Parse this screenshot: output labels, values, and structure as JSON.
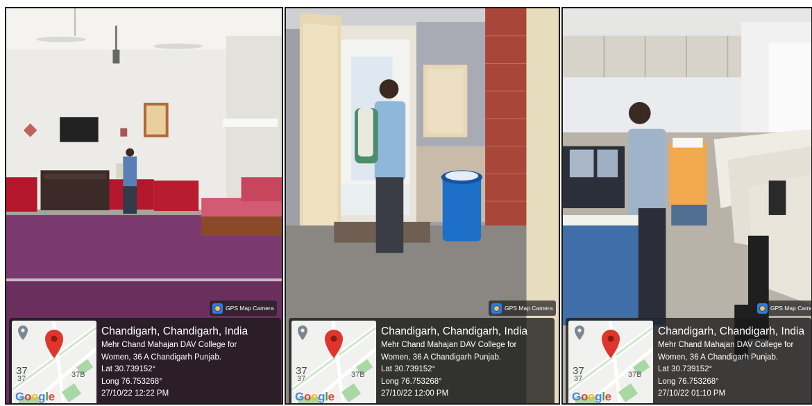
{
  "overlay": {
    "app_name": "GPS Map Camera",
    "map_label_main": "37",
    "map_label_sub": "37",
    "map_label_right": "37B",
    "map_brand": [
      "G",
      "o",
      "o",
      "g",
      "l",
      "e"
    ],
    "city": "Chandigarh, Chandigarh, India",
    "address_line1": "Mehr Chand Mahajan DAV College for",
    "address_line2": "Women, 36 A Chandigarh Punjab.",
    "lat": "Lat 30.739152°",
    "long": "Long 76.753268°"
  },
  "photos": [
    {
      "scene": "hall with purple carpet, red sofas and wall-mounted tv",
      "timestamp": "27/10/22 12:22 PM"
    },
    {
      "scene": "washroom corridor with blue dustbin and brick wall",
      "timestamp": "27/10/22 12:00 PM"
    },
    {
      "scene": "computer lab with cubicles",
      "timestamp": "27/10/22 01:10 PM"
    }
  ],
  "colors": {
    "card_bg": "#191919",
    "map_pin": "#e0352b",
    "carpet": "#6b2f5e"
  }
}
